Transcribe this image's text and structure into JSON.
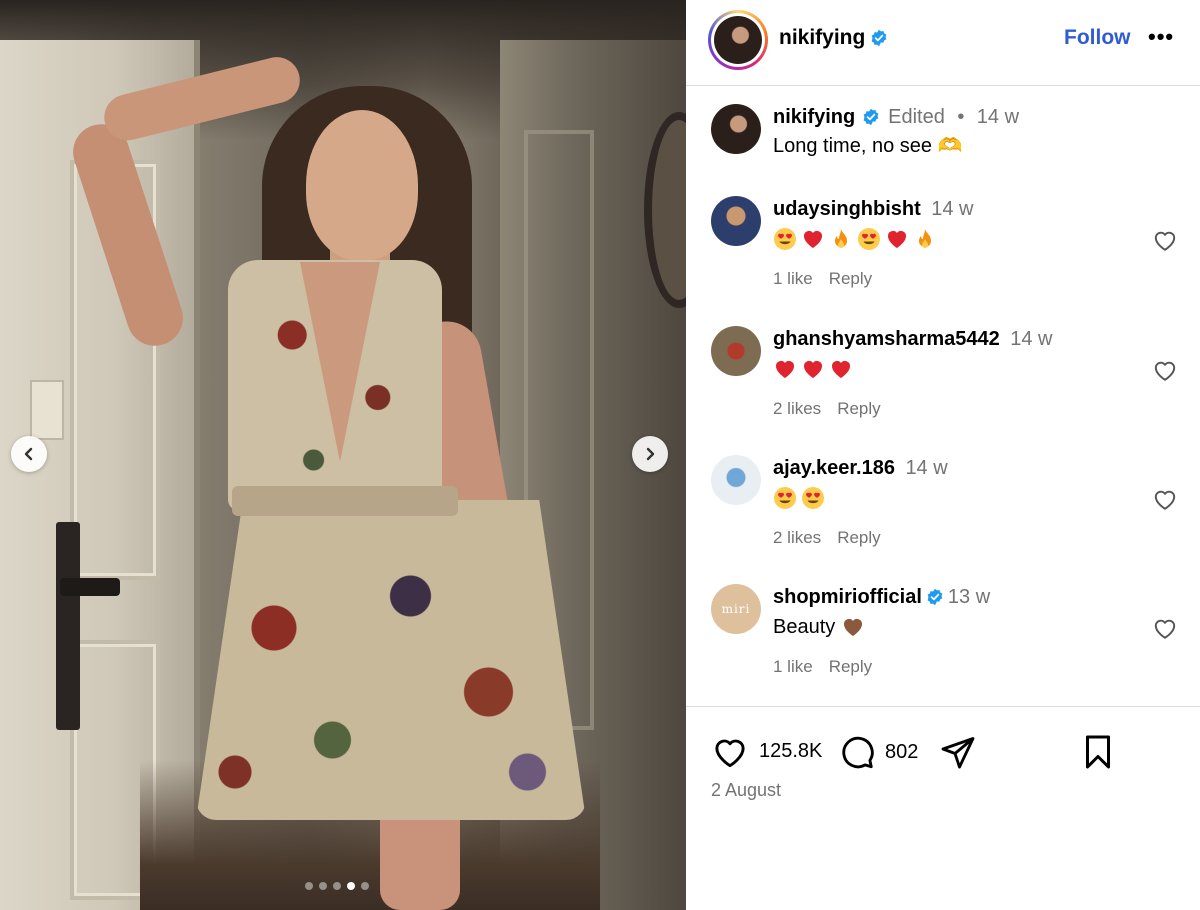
{
  "post": {
    "author": "nikifying",
    "follow_label": "Follow",
    "more_label": "•••",
    "carousel": {
      "count": 5,
      "active_index": 3
    }
  },
  "caption": {
    "username": "nikifying",
    "edited": "Edited",
    "separator": "•",
    "age": "14 w",
    "text": "Long time, no see 🫶"
  },
  "comments": [
    {
      "username": "udaysinghbisht",
      "age": "14 w",
      "verified": false,
      "emojis": [
        "heart-eyes",
        "red-heart",
        "fire",
        "heart-eyes",
        "red-heart",
        "fire"
      ],
      "text": "",
      "likes": "1 like",
      "reply": "Reply"
    },
    {
      "username": "ghanshyamsharma5442",
      "age": "14 w",
      "verified": false,
      "emojis": [
        "red-heart",
        "red-heart",
        "red-heart"
      ],
      "text": "",
      "likes": "2 likes",
      "reply": "Reply"
    },
    {
      "username": "ajay.keer.186",
      "age": "14 w",
      "verified": false,
      "emojis": [
        "heart-eyes",
        "heart-eyes"
      ],
      "text": "",
      "likes": "2 likes",
      "reply": "Reply"
    },
    {
      "username": "shopmiriofficial",
      "age": "13 w",
      "verified": true,
      "emojis": [
        "brown-heart"
      ],
      "text": "Beauty",
      "likes": "1 like",
      "reply": "Reply"
    }
  ],
  "footer": {
    "likes": "125.8K",
    "comments": "802",
    "date": "2 August"
  },
  "avatars": {
    "shopmiri_text": "miri"
  },
  "colors": {
    "follow": "#2f5bd4",
    "verified": "#1d9bf0",
    "muted": "#737373",
    "border": "#dbdbdb"
  }
}
